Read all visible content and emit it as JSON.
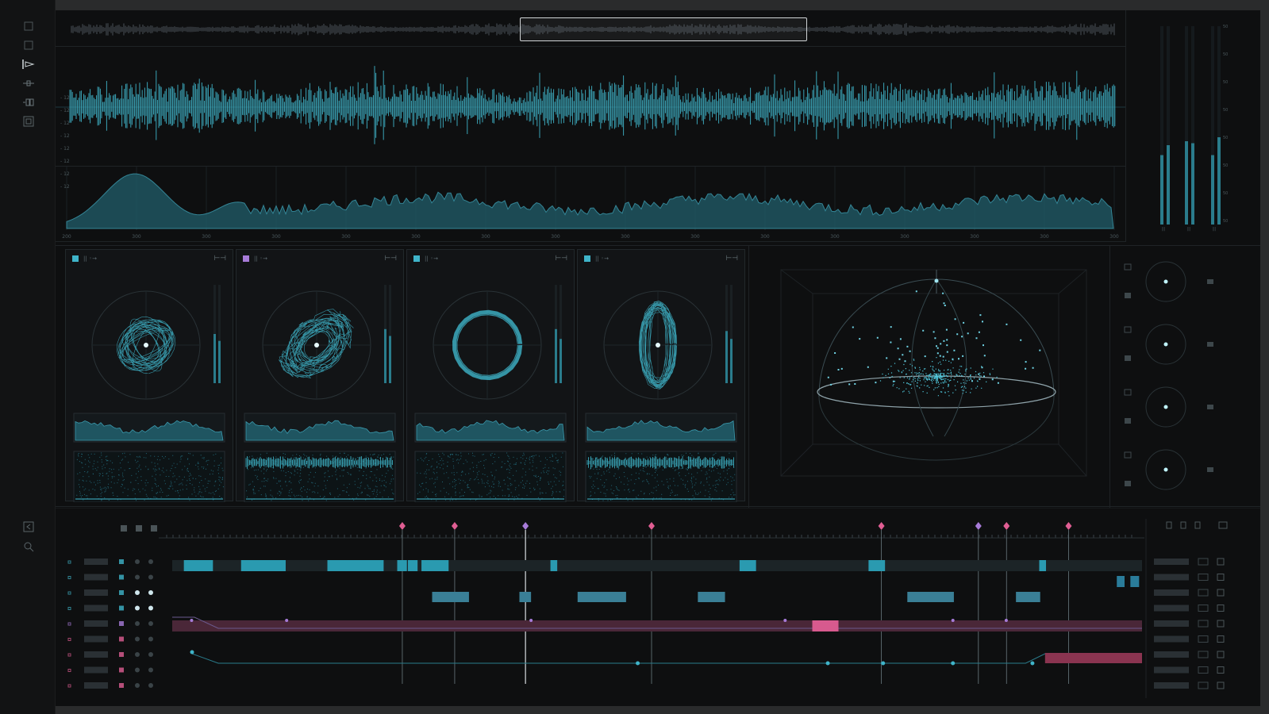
{
  "colors": {
    "accent": "#3fb4c9",
    "accent_dim": "#2a7c8c",
    "pink": "#e05e93",
    "purple": "#a77bd8",
    "bg": "#0e0f10",
    "panel": "#121416"
  },
  "left_rail": {
    "icons": [
      "square-icon",
      "square-outline-icon",
      "waveform-select-icon",
      "pin-icon",
      "split-icon",
      "grid-icon",
      "collapse-icon",
      "search-icon"
    ]
  },
  "waveform": {
    "y_ticks": [
      "- 12",
      "- 12",
      "- 12",
      "- 12",
      "- 12",
      "- 12",
      "- 12",
      "- 12"
    ]
  },
  "envelope": {
    "x_ticks": [
      "200",
      "300",
      "300",
      "300",
      "300",
      "300",
      "300",
      "300",
      "300",
      "300",
      "300",
      "300",
      "300",
      "300",
      "300",
      "300"
    ]
  },
  "meters": {
    "scale": [
      "50",
      "50",
      "50",
      "50",
      "50",
      "50",
      "50",
      "50"
    ],
    "channel_labels": [
      "|||",
      "|||",
      "|||"
    ],
    "levels": [
      0.35,
      0.4,
      0.42,
      0.41,
      0.35,
      0.44
    ]
  },
  "scopes": [
    {
      "title": "|| ◦→",
      "color": "#3fb4c9",
      "shape": "tangle",
      "meter_levels": [
        0.5,
        0.43
      ]
    },
    {
      "title": "|| ◦→",
      "color": "#a77bd8",
      "shape": "ellipse",
      "meter_levels": [
        0.55,
        0.48
      ]
    },
    {
      "title": "|| ◦→",
      "color": "#3fb4c9",
      "shape": "ring",
      "meter_levels": [
        0.55,
        0.45
      ]
    },
    {
      "title": "|| ◦→",
      "color": "#3fb4c9",
      "shape": "vertical",
      "meter_levels": [
        0.53,
        0.45
      ]
    }
  ],
  "small_scopes": [
    {
      "name": "small-scope-1"
    },
    {
      "name": "small-scope-2"
    },
    {
      "name": "small-scope-3"
    },
    {
      "name": "small-scope-4"
    }
  ],
  "timeline": {
    "markers": [
      {
        "pos": 0.243,
        "color": "#e05e93"
      },
      {
        "pos": 0.297,
        "color": "#e05e93"
      },
      {
        "pos": 0.37,
        "color": "#a77bd8"
      },
      {
        "pos": 0.5,
        "color": "#e05e93"
      },
      {
        "pos": 0.737,
        "color": "#e05e93"
      },
      {
        "pos": 0.837,
        "color": "#a77bd8"
      },
      {
        "pos": 0.866,
        "color": "#e05e93"
      },
      {
        "pos": 0.93,
        "color": "#e05e93"
      }
    ],
    "tracks": [
      {
        "color": "#3fb4c9"
      },
      {
        "color": "#3fb4c9"
      },
      {
        "color": "#3fb4c9"
      },
      {
        "color": "#3fb4c9"
      },
      {
        "color": "#a77bd8"
      },
      {
        "color": "#e05e93"
      },
      {
        "color": "#e05e93"
      },
      {
        "color": "#e05e93"
      },
      {
        "color": "#e05e93"
      }
    ]
  }
}
